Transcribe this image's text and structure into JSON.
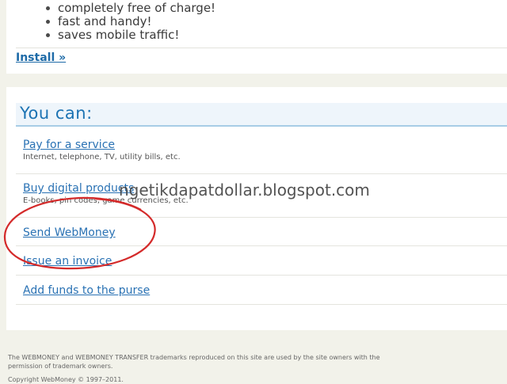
{
  "features": [
    "completely free of charge!",
    "fast and handy!",
    "saves mobile traffic!"
  ],
  "install": {
    "label": "Install »"
  },
  "you_can": {
    "title": "You can:",
    "actions": [
      {
        "label": "Pay for a service",
        "description": "Internet, telephone, TV, utility bills, etc."
      },
      {
        "label": "Buy digital products",
        "description": "E-books, pin codes, game currencies, etc."
      },
      {
        "label": "Send WebMoney",
        "description": ""
      },
      {
        "label": "Issue an invoice",
        "description": ""
      },
      {
        "label": "Add funds to the purse",
        "description": ""
      }
    ]
  },
  "watermark": "ngetikdapatdollar.blogspot.com",
  "footer": {
    "trademark_line1": "The WEBMONEY and WEBMONEY TRANSFER trademarks reproduced on this site are used by the site owners with the",
    "trademark_line2": "permission of trademark owners.",
    "copyright": "Copyright WebMoney © 1997–2011."
  },
  "colors": {
    "link": "#2a72b4",
    "header_text": "#1c73b3",
    "highlight_circle": "#d42a2a"
  }
}
